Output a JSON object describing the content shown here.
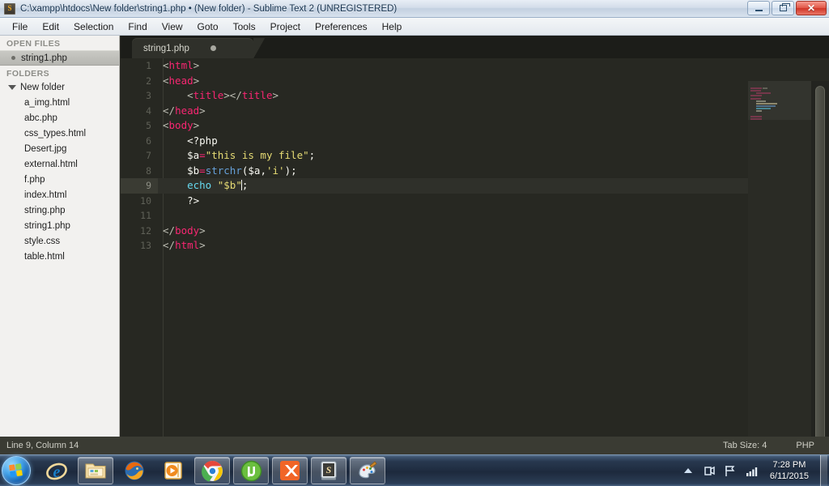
{
  "window": {
    "title": "C:\\xampp\\htdocs\\New folder\\string1.php • (New folder) - Sublime Text 2 (UNREGISTERED)",
    "app_icon": "sublime-text-icon",
    "controls": {
      "minimize": "minimize-icon",
      "restore": "restore-icon",
      "close": "close-icon"
    }
  },
  "menubar": {
    "items": [
      {
        "label": "File"
      },
      {
        "label": "Edit"
      },
      {
        "label": "Selection"
      },
      {
        "label": "Find"
      },
      {
        "label": "View"
      },
      {
        "label": "Goto"
      },
      {
        "label": "Tools"
      },
      {
        "label": "Project"
      },
      {
        "label": "Preferences"
      },
      {
        "label": "Help"
      }
    ]
  },
  "sidebar": {
    "open_files_header": "OPEN FILES",
    "open_files": [
      {
        "label": "string1.php",
        "selected": true
      }
    ],
    "folders_header": "FOLDERS",
    "folder": {
      "name": "New folder",
      "expanded": true,
      "files": [
        {
          "label": "a_img.html"
        },
        {
          "label": "abc.php"
        },
        {
          "label": "css_types.html"
        },
        {
          "label": "Desert.jpg"
        },
        {
          "label": "external.html"
        },
        {
          "label": "f.php"
        },
        {
          "label": "index.html"
        },
        {
          "label": "string.php"
        },
        {
          "label": "string1.php"
        },
        {
          "label": "style.css"
        },
        {
          "label": "table.html"
        }
      ]
    }
  },
  "editor": {
    "tabs": [
      {
        "label": "string1.php",
        "dirty": true,
        "active": true
      }
    ],
    "active_line": 9,
    "line_numbers": [
      1,
      2,
      3,
      4,
      5,
      6,
      7,
      8,
      9,
      10,
      11,
      12,
      13
    ],
    "lines": [
      {
        "n": 1,
        "text": "<html>"
      },
      {
        "n": 2,
        "text": "<head>"
      },
      {
        "n": 3,
        "text": "    <title></title>"
      },
      {
        "n": 4,
        "text": "</head>"
      },
      {
        "n": 5,
        "text": "<body>"
      },
      {
        "n": 6,
        "text": "    <?php"
      },
      {
        "n": 7,
        "text": "    $a=\"this is my file\";"
      },
      {
        "n": 8,
        "text": "    $b=strchr($a,'i');"
      },
      {
        "n": 9,
        "text": "    echo \"$b\";"
      },
      {
        "n": 10,
        "text": "    ?>"
      },
      {
        "n": 11,
        "text": ""
      },
      {
        "n": 12,
        "text": "</body>"
      },
      {
        "n": 13,
        "text": "</html>"
      }
    ],
    "colors": {
      "background": "#272822",
      "tag": "#f92672",
      "keyword": "#66d9ef",
      "function": "#66a0d9",
      "string": "#e6db74",
      "punctuation": "#bcbcb2",
      "plain": "#f8f8f2",
      "gutter_text": "#5f6057"
    }
  },
  "statusbar": {
    "cursor_position": "Line 9, Column 14",
    "tab_size": "Tab Size: 4",
    "syntax": "PHP"
  },
  "taskbar": {
    "start_label": "start-orb",
    "buttons": [
      {
        "name": "internet-explorer-icon",
        "pinned": false
      },
      {
        "name": "windows-explorer-icon",
        "pinned": true
      },
      {
        "name": "firefox-icon",
        "pinned": false
      },
      {
        "name": "windows-media-player-icon",
        "pinned": false
      },
      {
        "name": "google-chrome-icon",
        "pinned": true
      },
      {
        "name": "utorrent-icon",
        "pinned": true
      },
      {
        "name": "xampp-icon",
        "pinned": true
      },
      {
        "name": "sublime-text-icon",
        "pinned": true
      },
      {
        "name": "paint-icon",
        "pinned": true
      }
    ],
    "tray": {
      "show_hidden": "chevron-up-icon",
      "icons": [
        "action-center-icon",
        "network-icon",
        "volume-icon"
      ],
      "time": "7:28 PM",
      "date": "6/11/2015"
    }
  }
}
